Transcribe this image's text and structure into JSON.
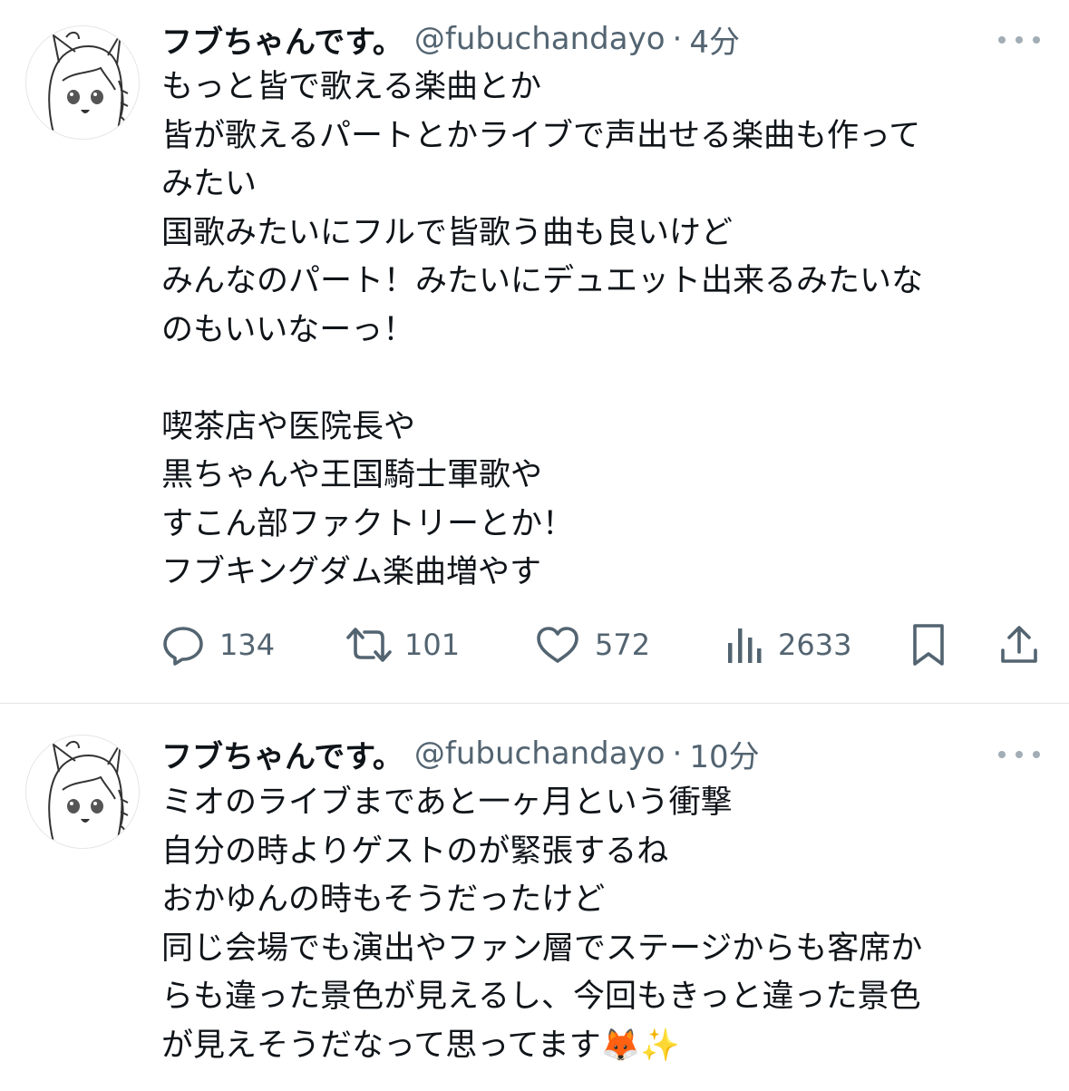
{
  "tweets": [
    {
      "name": "フブちゃんです。",
      "handle": "@fubuchandayo",
      "separator": "·",
      "time": "4分",
      "lines": [
        "もっと皆で歌える楽曲とか",
        "皆が歌えるパートとかライブで声出せる楽曲も作って",
        "みたい",
        "国歌みたいにフルで皆歌う曲も良いけど",
        "みんなのパート！みたいにデュエット出来るみたいな",
        "のもいいなーっ！",
        "",
        "喫茶店や医院長や",
        "黒ちゃんや王国騎士軍歌や",
        "すこん部ファクトリーとか！",
        "フブキングダム楽曲増やす"
      ],
      "stats": {
        "replies": "134",
        "retweets": "101",
        "likes": "572",
        "views": "2633"
      }
    },
    {
      "name": "フブちゃんです。",
      "handle": "@fubuchandayo",
      "separator": "·",
      "time": "10分",
      "lines": [
        "ミオのライブまであと一ヶ月という衝撃",
        "自分の時よりゲストのが緊張するね",
        "おかゆんの時もそうだったけど",
        "同じ会場でも演出やファン層でステージからも客席か",
        "らも違った景色が見えるし、今回もきっと違った景色",
        "が見えそうだなって思ってます🦊✨"
      ]
    }
  ],
  "colors": {
    "text": "#0f1419",
    "secondary": "#536471",
    "divider": "#e4e6e8",
    "more_dots": "#a2adb5"
  },
  "icons": [
    "avatar",
    "more-icon",
    "reply-icon",
    "retweet-icon",
    "like-icon",
    "views-icon",
    "bookmark-icon",
    "share-icon"
  ]
}
